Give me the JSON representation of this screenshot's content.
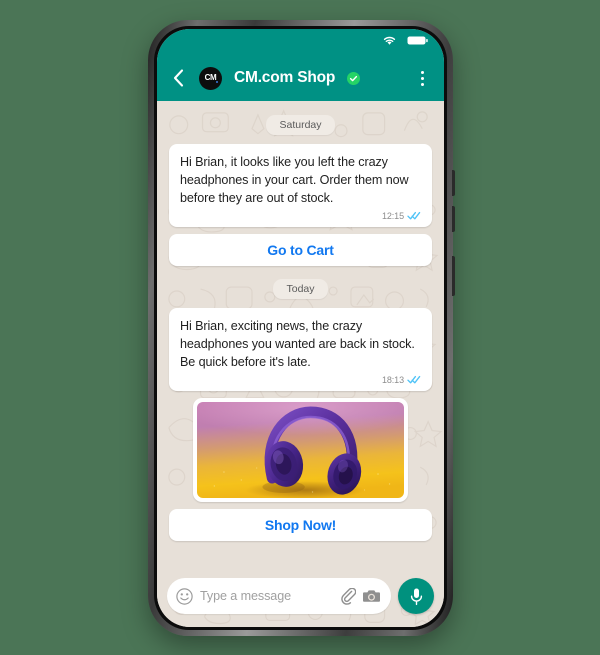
{
  "theme": {
    "page_background": "#4b7556",
    "header_green": "#009184",
    "chat_background": "#e7e0d8",
    "bubble_white": "#ffffff",
    "cta_blue": "#1178f0",
    "mic_green": "#00917e",
    "verified_green": "#25d366"
  },
  "status_bar": {
    "wifi_icon": "wifi-icon",
    "battery_icon": "battery-icon"
  },
  "header": {
    "back_icon": "back-chevron-icon",
    "avatar_initials": "CM",
    "contact_name": "CM.com Shop",
    "verified_icon": "verified-check-icon",
    "menu_icon": "overflow-menu-icon"
  },
  "conversation": [
    {
      "type": "date_separator",
      "label": "Saturday"
    },
    {
      "type": "message",
      "text": "Hi Brian, it looks like you left the crazy headphones in your cart. Order them now before they are out of stock.",
      "time": "12:15",
      "receipt_icon": "double-check-read-icon"
    },
    {
      "type": "cta",
      "label": "Go to Cart"
    },
    {
      "type": "date_separator",
      "label": "Today"
    },
    {
      "type": "message",
      "text": "Hi Brian, exciting news, the crazy headphones you wanted are back in stock. Be quick before it's late.",
      "time": "18:13",
      "receipt_icon": "double-check-read-icon"
    },
    {
      "type": "media",
      "alt": "purple-headphones-photo"
    },
    {
      "type": "cta",
      "label": "Shop Now!"
    }
  ],
  "input_bar": {
    "emoji_icon": "smiley-emoji-icon",
    "placeholder": "Type a message",
    "value": "",
    "attach_icon": "paperclip-icon",
    "camera_icon": "camera-icon",
    "mic_icon": "microphone-icon"
  }
}
